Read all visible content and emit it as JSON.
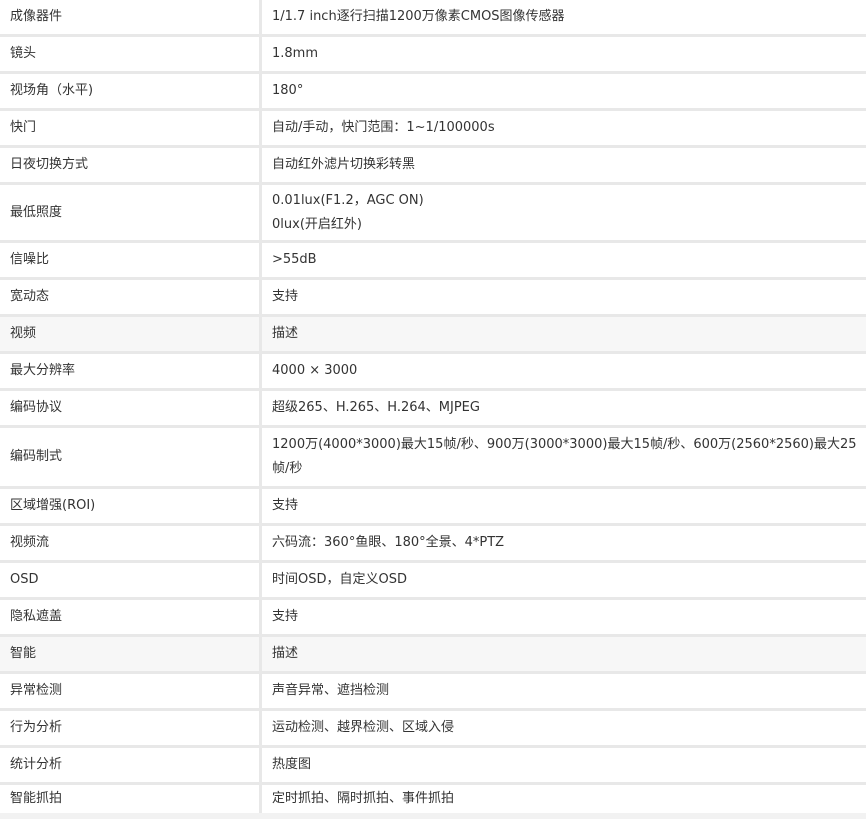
{
  "spec_table": {
    "rows": [
      {
        "label": "成像器件",
        "value": "1/1.7 inch逐行扫描1200万像素CMOS图像传感器"
      },
      {
        "label": "镜头",
        "value": "1.8mm"
      },
      {
        "label": "视场角（水平)",
        "value": "180°"
      },
      {
        "label": "快门",
        "value": "自动/手动，快门范围：1~1/100000s"
      },
      {
        "label": "日夜切换方式",
        "value": "自动红外滤片切换彩转黑"
      },
      {
        "label": "最低照度",
        "value": "0.01lux(F1.2，AGC ON)\n0lux(开启红外)"
      },
      {
        "label": "信噪比",
        "value": ">55dB"
      },
      {
        "label": "宽动态",
        "value": "支持"
      },
      {
        "label": "视频",
        "value": "描述",
        "section": true
      },
      {
        "label": "最大分辨率",
        "value": "4000 × 3000"
      },
      {
        "label": "编码协议",
        "value": "超级265、H.265、H.264、MJPEG"
      },
      {
        "label": "编码制式",
        "value": "1200万(4000*3000)最大15帧/秒、900万(3000*3000)最大15帧/秒、600万(2560*2560)最大25帧/秒"
      },
      {
        "label": "区域增强(ROI)",
        "value": "支持"
      },
      {
        "label": "视频流",
        "value": "六码流：360°鱼眼、180°全景、4*PTZ"
      },
      {
        "label": "OSD",
        "value": "时间OSD，自定义OSD"
      },
      {
        "label": "隐私遮盖",
        "value": "支持"
      },
      {
        "label": "智能",
        "value": "描述",
        "section": true
      },
      {
        "label": "异常检测",
        "value": "声音异常、遮挡检测"
      },
      {
        "label": "行为分析",
        "value": "运动检测、越界检测、区域入侵"
      },
      {
        "label": "统计分析",
        "value": "热度图"
      },
      {
        "label": "智能抓拍",
        "value": "定时抓拍、隔时抓拍、事件抓拍"
      }
    ]
  }
}
